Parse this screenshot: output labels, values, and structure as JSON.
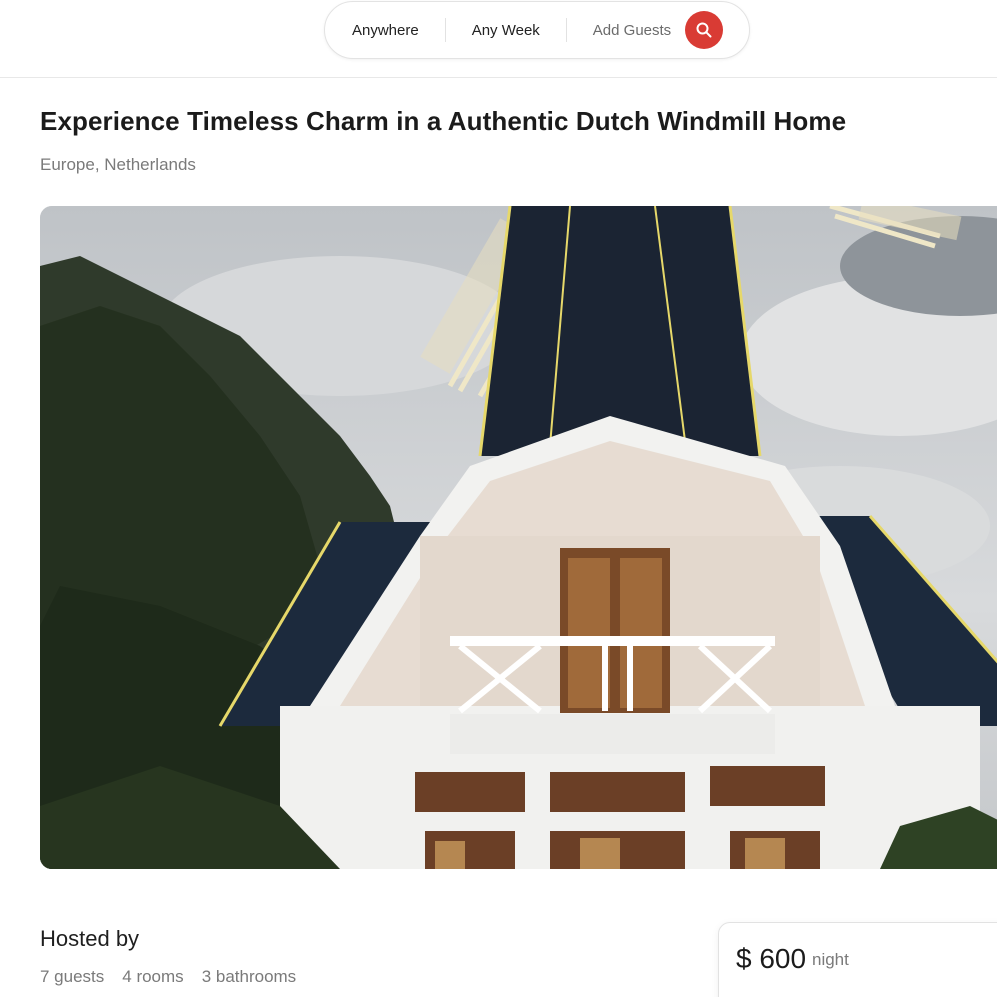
{
  "search": {
    "where": "Anywhere",
    "when": "Any Week",
    "guests": "Add Guests"
  },
  "listing": {
    "title": "Experience Timeless Charm in a Authentic Dutch Windmill Home",
    "location": "Europe, Netherlands",
    "photo_icon": "windmill-house-photo",
    "hosted_by": "Hosted by",
    "stats": [
      "7 guests",
      "4 rooms",
      "3 bathrooms"
    ]
  },
  "booking": {
    "price": "$ 600",
    "per": "night"
  },
  "colors": {
    "accent": "#d93b34",
    "muted_text": "#7a7a7a"
  }
}
